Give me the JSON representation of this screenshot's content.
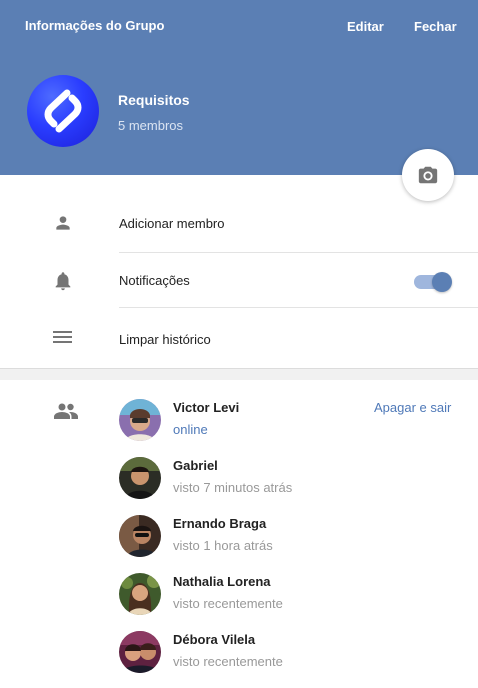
{
  "header": {
    "title": "Informações do Grupo",
    "edit_label": "Editar",
    "close_label": "Fechar",
    "background": "#5b7fb4"
  },
  "group": {
    "name": "Requisitos",
    "member_count": "5 membros",
    "avatar_icon": "shazam-logo",
    "camera_icon": "camera-icon"
  },
  "actions": [
    {
      "label": "Adicionar membro",
      "icon": "person-icon"
    },
    {
      "label": "Notificações",
      "icon": "bell-icon",
      "toggle_on": true
    },
    {
      "label": "Limpar histórico",
      "icon": "menu-lines-icon"
    }
  ],
  "members_section": {
    "icon": "group-icon",
    "leave_label": "Apagar e sair",
    "accent": "#4f79b8"
  },
  "members": [
    {
      "name": "Victor Levi",
      "status": "online",
      "online": true
    },
    {
      "name": "Gabriel",
      "status": "visto 7 minutos atrás",
      "online": false
    },
    {
      "name": "Ernando Braga",
      "status": "visto 1 hora atrás",
      "online": false
    },
    {
      "name": "Nathalia Lorena",
      "status": "visto recentemente",
      "online": false
    },
    {
      "name": "Débora Vilela",
      "status": "visto recentemente",
      "online": false
    }
  ]
}
